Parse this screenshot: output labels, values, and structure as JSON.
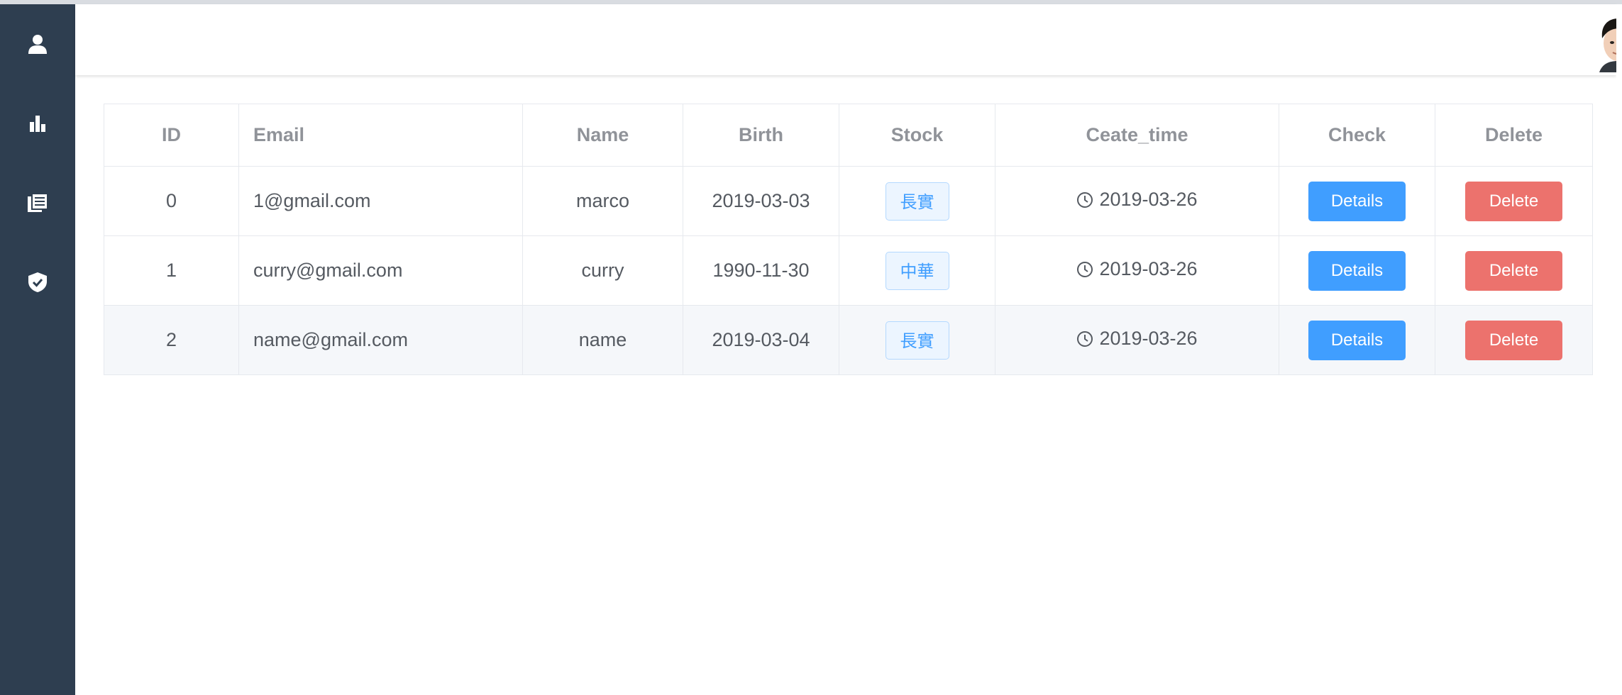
{
  "sidebar": {
    "items": [
      {
        "icon": "user-icon"
      },
      {
        "icon": "bar-chart-icon"
      },
      {
        "icon": "documents-icon"
      },
      {
        "icon": "shield-check-icon"
      }
    ]
  },
  "header": {
    "avatar": "user-avatar"
  },
  "table": {
    "columns": [
      "ID",
      "Email",
      "Name",
      "Birth",
      "Stock",
      "Ceate_time",
      "Check",
      "Delete"
    ],
    "rows": [
      {
        "id": "0",
        "email": "1@gmail.com",
        "name": "marco",
        "birth": "2019-03-03",
        "stock": "長實",
        "create_time": "2019-03-26",
        "check_label": "Details",
        "delete_label": "Delete"
      },
      {
        "id": "1",
        "email": "curry@gmail.com",
        "name": "curry",
        "birth": "1990-11-30",
        "stock": "中華",
        "create_time": "2019-03-26",
        "check_label": "Details",
        "delete_label": "Delete"
      },
      {
        "id": "2",
        "email": "name@gmail.com",
        "name": "name",
        "birth": "2019-03-04",
        "stock": "長實",
        "create_time": "2019-03-26",
        "check_label": "Details",
        "delete_label": "Delete"
      }
    ]
  },
  "colors": {
    "sidebar": "#2e3e50",
    "primary": "#409eff",
    "danger": "#ec726d",
    "tag_bg": "#ecf5ff",
    "stripe": "#f5f7fa"
  }
}
